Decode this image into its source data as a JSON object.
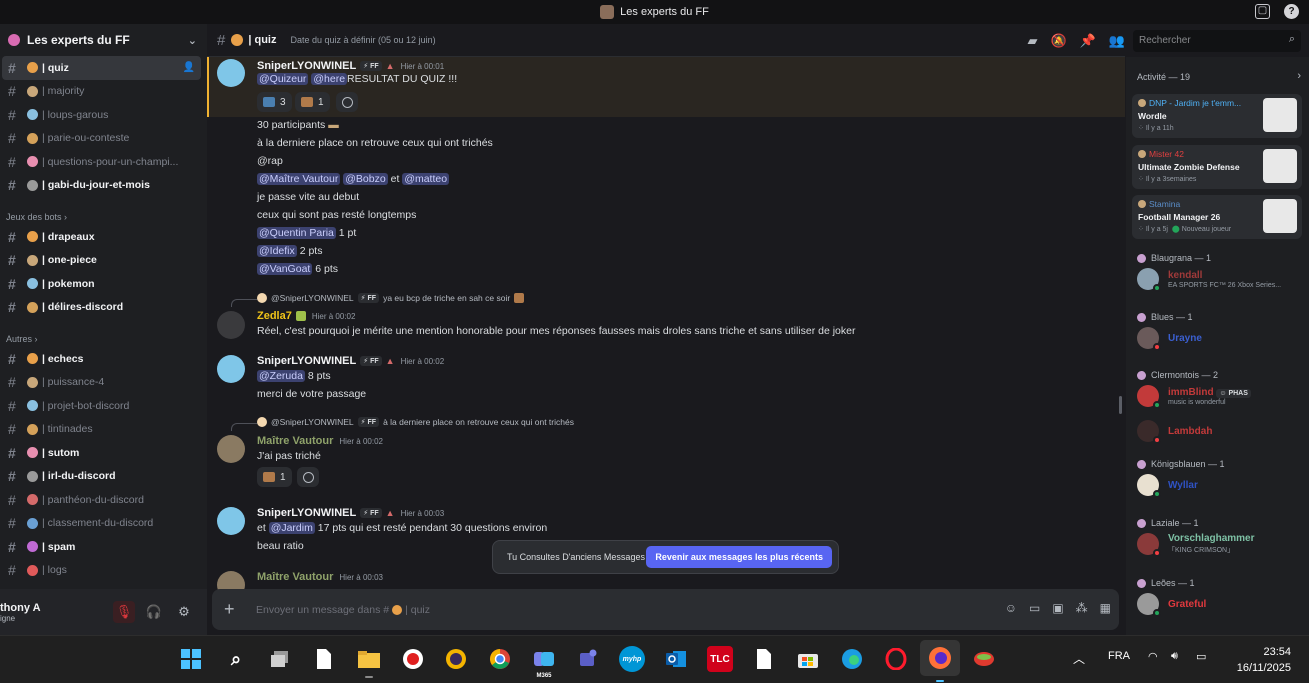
{
  "window": {
    "title": "Les experts du FF"
  },
  "server": {
    "name": "Les experts du FF"
  },
  "channels_top": [
    {
      "label": "| quiz",
      "active": true
    },
    {
      "label": "| majority"
    },
    {
      "label": "| loups-garous"
    },
    {
      "label": "| parie-ou-conteste"
    },
    {
      "label": "| questions-pour-un-champi..."
    },
    {
      "label": "| gabi-du-jour-et-mois",
      "bold": true
    }
  ],
  "category_bots": "Jeux des bots",
  "channels_bots": [
    {
      "label": "| drapeaux",
      "bold": true
    },
    {
      "label": "| one-piece",
      "bold": true
    },
    {
      "label": "| pokemon",
      "bold": true
    },
    {
      "label": "| délires-discord",
      "bold": true
    }
  ],
  "category_autres": "Autres",
  "channels_autres": [
    {
      "label": "| echecs",
      "bold": true
    },
    {
      "label": "| puissance-4"
    },
    {
      "label": "| projet-bot-discord"
    },
    {
      "label": "| tintinades"
    },
    {
      "label": "| sutom",
      "bold": true
    },
    {
      "label": "| irl-du-discord",
      "bold": true
    },
    {
      "label": "| panthéon-du-discord"
    },
    {
      "label": "| classement-du-discord"
    },
    {
      "label": "| spam",
      "bold": true
    },
    {
      "label": "| logs"
    }
  ],
  "user": {
    "name": "thony A",
    "status": "igne"
  },
  "channel_header": {
    "name": "| quiz",
    "topic": "Date du quiz à définir (05 ou 12 juin)"
  },
  "search": {
    "placeholder": "Rechercher"
  },
  "messages": {
    "m1": {
      "author": "SniperLYONWINEL",
      "tag": "FF",
      "time": "Hier à 00:01",
      "mention1": "@Quizeur",
      "mention2": "@here",
      "text": "RESULTAT DU QUIZ !!!",
      "react1": "3",
      "react2": "1"
    },
    "lines": {
      "l1": "30 participants",
      "l2": "à la derniere place on retrouve ceux qui ont trichés",
      "l3": "@rap",
      "l4a": "@Maître Vautour",
      "l4b": "@Bobzo",
      "l4c": "et",
      "l4d": "@matteo",
      "l5": "je passe vite au debut",
      "l6": "ceux qui sont pas resté longtemps",
      "l7a": "@Quentin Paria",
      "l7b": "1 pt",
      "l8a": "@Idefix",
      "l8b": "2 pts",
      "l9a": "@VanGoat",
      "l9b": "6 pts"
    },
    "m2": {
      "reply_author": "@SniperLYONWINEL",
      "reply_tag": "FF",
      "reply_text": "ya eu bcp de triche en sah ce soir",
      "author": "Zedla7",
      "time": "Hier à 00:02",
      "text": "Réel, c'est pourquoi je mérite une mention honorable pour mes réponses fausses mais droles sans triche et sans utiliser de joker"
    },
    "m3": {
      "author": "SniperLYONWINEL",
      "tag": "FF",
      "time": "Hier à 00:02",
      "mention": "@Zeruda",
      "text1": "8 pts",
      "text2": "merci de votre passage"
    },
    "m4": {
      "reply_author": "@SniperLYONWINEL",
      "reply_tag": "FF",
      "reply_text": "à la derniere place on retrouve ceux qui ont trichés",
      "author": "Maître Vautour",
      "time": "Hier à 00:02",
      "text": "J'ai pas triché",
      "react1": "1"
    },
    "m5": {
      "author": "SniperLYONWINEL",
      "tag": "FF",
      "time": "Hier à 00:03",
      "text_a": "et",
      "mention": "@Jardim",
      "text_b": "17 pts qui est resté pendant 30 questions environ",
      "text2": "beau ratio"
    },
    "m6": {
      "author": "Maître Vautour",
      "time": "Hier à 00:03"
    }
  },
  "toast": {
    "text": "Tu Consultes D'anciens Messages",
    "button": "Revenir aux messages les plus récents"
  },
  "composer": {
    "placeholder": "Envoyer un message dans #",
    "channel": "| quiz"
  },
  "activity": {
    "title": "Activité — 19",
    "cards": [
      {
        "user": "DNP - Jardim je t'emm...",
        "user_color": "#4fb1f5",
        "game": "Wordle",
        "time": "Il y a 11h"
      },
      {
        "user": "Mister 42",
        "user_color": "#e04040",
        "game": "Ultimate Zombie Defense",
        "time": "Il y a 3semaines"
      },
      {
        "user": "Stamina",
        "user_color": "#5b8ec9",
        "game": "Football Manager 26",
        "time": "Il y a 5j",
        "extra": "Nouveau joueur"
      }
    ]
  },
  "member_groups": [
    {
      "title": "Blaugrana — 1",
      "members": [
        {
          "name": "kendall",
          "color": "#a03a3a",
          "status": "EA SPORTS FC™ 26 Xbox Series..."
        }
      ]
    },
    {
      "title": "Blues — 1",
      "members": [
        {
          "name": "Urayne",
          "color": "#3b5fd0"
        }
      ]
    },
    {
      "title": "Clermontois — 2",
      "members": [
        {
          "name": "immBlind",
          "color": "#c23a3a",
          "badge": "PHAS",
          "status": "music is wonderful"
        },
        {
          "name": "Lambdah",
          "color": "#c23a3a"
        }
      ]
    },
    {
      "title": "Königsblauen — 1",
      "members": [
        {
          "name": "Wyllar",
          "color": "#2f52c4"
        }
      ]
    },
    {
      "title": "Laziale — 1",
      "members": [
        {
          "name": "Vorschlaghammer",
          "color": "#7ec1a5",
          "status": "「KING CRIMSON」"
        }
      ]
    },
    {
      "title": "Leões — 1",
      "members": [
        {
          "name": "Grateful",
          "color": "#e0393e"
        }
      ]
    }
  ],
  "taskbar": {
    "lang": "FRA",
    "time": "23:54",
    "date": "16/11/2025",
    "m365_label": "M365",
    "teams_label": "myhp",
    "tlc_label": "TLC"
  }
}
